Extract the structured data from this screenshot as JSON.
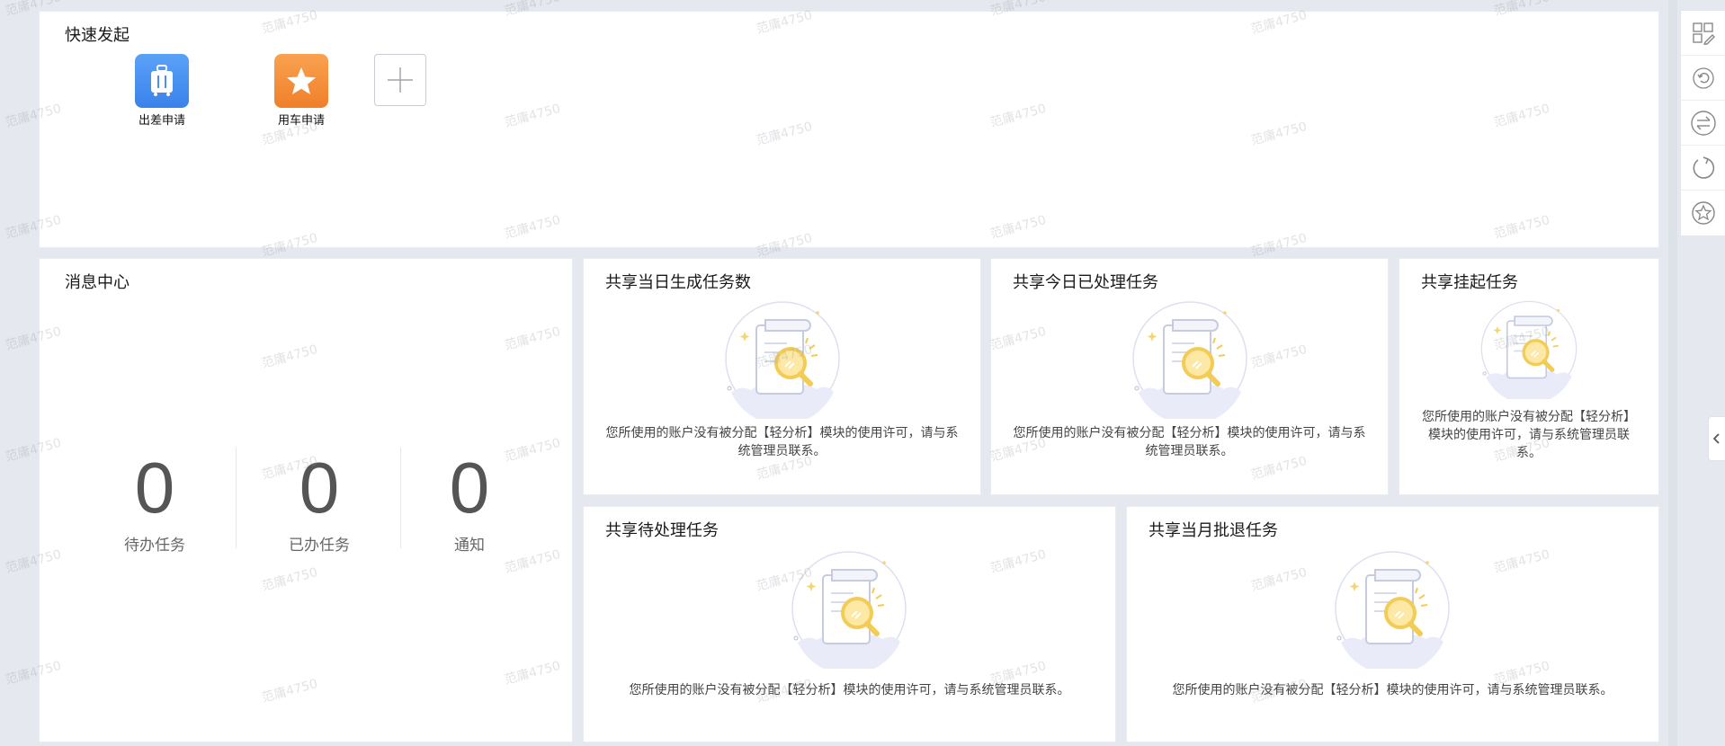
{
  "quick_launch": {
    "title": "快速发起",
    "items": [
      {
        "label": "出差申请",
        "icon": "suitcase-icon",
        "color": "#4a90f0"
      },
      {
        "label": "用车申请",
        "icon": "star-icon",
        "color": "#f5923e"
      }
    ],
    "add_icon": "plus-icon"
  },
  "message_center": {
    "title": "消息中心",
    "stats": [
      {
        "value": "0",
        "label": "待办任务"
      },
      {
        "value": "0",
        "label": "已办任务"
      },
      {
        "value": "0",
        "label": "通知"
      }
    ]
  },
  "shared_cards": [
    {
      "title": "共享当日生成任务数",
      "note": "您所使用的账户没有被分配【轻分析】模块的使用许可，请与系统管理员联系。"
    },
    {
      "title": "共享今日已处理任务",
      "note": "您所使用的账户没有被分配【轻分析】模块的使用许可，请与系统管理员联系。"
    },
    {
      "title": "共享挂起任务",
      "note": "您所使用的账户没有被分配【轻分析】模块的使用许可，请与系统管理员联系。"
    },
    {
      "title": "共享待处理任务",
      "note": "您所使用的账户没有被分配【轻分析】模块的使用许可，请与系统管理员联系。"
    },
    {
      "title": "共享当月批退任务",
      "note": "您所使用的账户没有被分配【轻分析】模块的使用许可，请与系统管理员联系。"
    }
  ],
  "toolbar": {
    "buttons": [
      "layout-edit-icon",
      "reset-icon",
      "switch-icon",
      "refresh-icon",
      "favorite-icon"
    ]
  },
  "watermark": "范庸4750",
  "colors": {
    "background": "#e5e8ee",
    "card": "#ffffff"
  }
}
